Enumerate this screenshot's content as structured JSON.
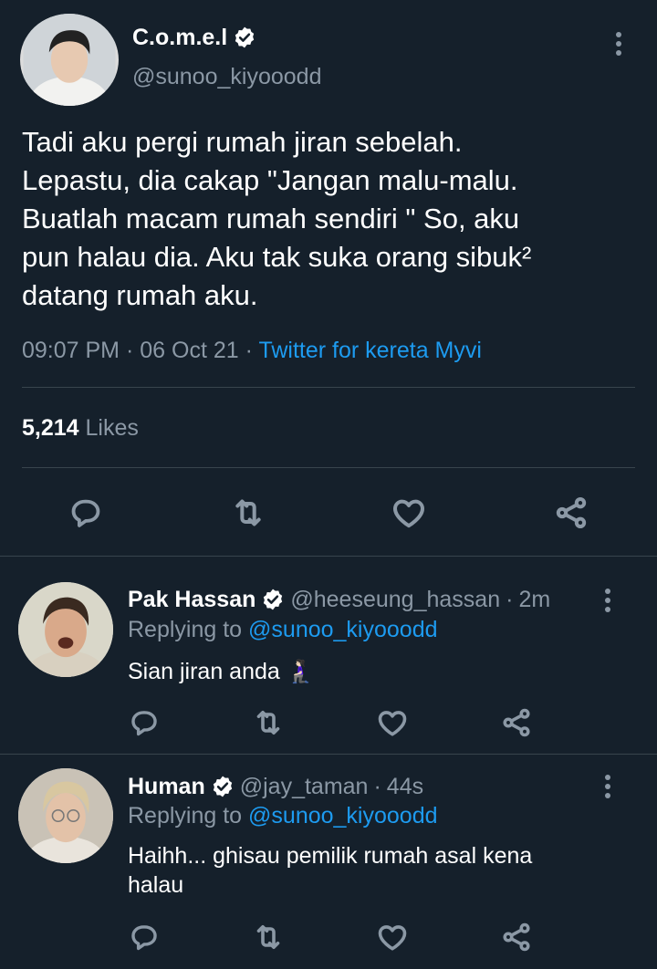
{
  "main_tweet": {
    "display_name": "C.o.m.e.l",
    "handle": "@sunoo_kiyooodd",
    "text_lines": [
      "Tadi aku pergi rumah jiran sebelah.",
      "Lepastu, dia cakap \"Jangan malu-malu.",
      "Buatlah macam rumah sendiri \" So, aku",
      "pun halau dia. Aku tak suka orang sibuk²",
      "datang rumah aku."
    ],
    "time": "09:07 PM",
    "date": "06 Oct 21",
    "separator": "·",
    "source": "Twitter for kereta Myvi",
    "likes_count": "5,214",
    "likes_label": "Likes"
  },
  "replies": [
    {
      "display_name": "Pak Hassan",
      "handle": "@heeseung_hassan",
      "separator": "·",
      "age": "2m",
      "replying_prefix": "Replying to",
      "replying_to": "@sunoo_kiyooodd",
      "text_lines": [
        "Sian jiran anda 🧎🏻‍♀️"
      ]
    },
    {
      "display_name": "Human",
      "handle": "@jay_taman",
      "separator": "·",
      "age": "44s",
      "replying_prefix": "Replying to",
      "replying_to": "@sunoo_kiyooodd",
      "text_lines": [
        "Haihh... ghisau pemilik rumah asal kena",
        "halau"
      ]
    }
  ],
  "icons": [
    "more-vertical-icon",
    "verified-badge-icon",
    "reply-icon",
    "retweet-icon",
    "like-icon",
    "share-icon"
  ],
  "colors": {
    "background": "#15202b",
    "text": "#ffffff",
    "muted": "#8b98a5",
    "link": "#1d9bf0",
    "divider": "#38444d"
  }
}
